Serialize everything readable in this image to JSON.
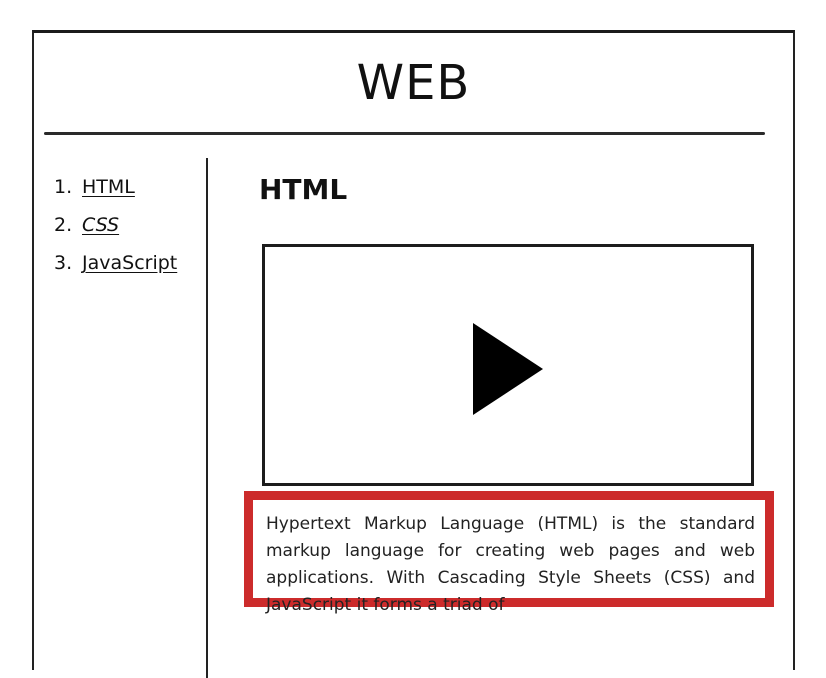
{
  "header": {
    "title": "WEB"
  },
  "nav": {
    "items": [
      {
        "number": "1.",
        "label": "HTML"
      },
      {
        "number": "2.",
        "label": "CSS"
      },
      {
        "number": "3.",
        "label": "JavaScript"
      }
    ]
  },
  "main": {
    "heading": "HTML",
    "video": {
      "icon": "play-icon"
    },
    "description": "Hypertext Markup Language (HTML) is the standard markup language for creating web pages and web applications. With Cascading Style Sheets (CSS) and JavaScript it forms a triad of"
  },
  "colors": {
    "highlight_border": "#cc2b2b",
    "ink": "#111111"
  }
}
